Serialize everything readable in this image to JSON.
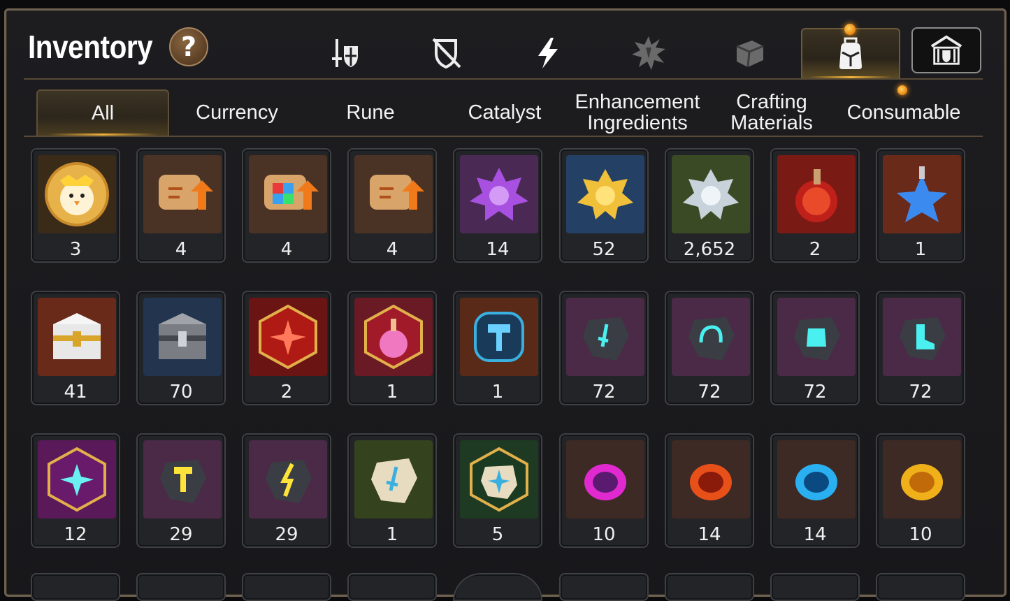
{
  "header": {
    "title": "Inventory",
    "help_label": "?"
  },
  "category_tabs": [
    {
      "icon": "hero-equipment-icon"
    },
    {
      "icon": "artifact-icon"
    },
    {
      "icon": "skill-lightning-icon"
    },
    {
      "icon": "burst-emblem-icon"
    },
    {
      "icon": "box-material-icon"
    },
    {
      "icon": "bag-icon",
      "active": true
    },
    {
      "icon": "guild-storage-icon"
    }
  ],
  "subtabs": [
    "All",
    "Currency",
    "Rune",
    "Catalyst",
    "Enhancement Ingredients",
    "Crafting Materials",
    "Consumable"
  ],
  "active_subtab": "All",
  "items": [
    {
      "icon": "chick-portrait-icon",
      "count": "3"
    },
    {
      "icon": "scroll-upgrade-icon",
      "count": "4"
    },
    {
      "icon": "rainbow-scroll-upgrade-icon",
      "count": "4"
    },
    {
      "icon": "scroll-upgrade-icon",
      "count": "4"
    },
    {
      "icon": "purple-crystal-icon",
      "count": "14"
    },
    {
      "icon": "gold-crystal-icon",
      "count": "52"
    },
    {
      "icon": "silver-crystal-icon",
      "count": "2,652"
    },
    {
      "icon": "red-potion-icon",
      "count": "2"
    },
    {
      "icon": "star-potion-icon",
      "count": "1"
    },
    {
      "icon": "gold-chest-icon",
      "count": "41"
    },
    {
      "icon": "iron-chest-icon",
      "count": "70"
    },
    {
      "icon": "red-rune-stone-icon",
      "count": "2"
    },
    {
      "icon": "pink-potion-icon",
      "count": "1"
    },
    {
      "icon": "hammer-rune-icon",
      "count": "1"
    },
    {
      "icon": "sword-stone-icon",
      "count": "72"
    },
    {
      "icon": "helm-stone-icon",
      "count": "72"
    },
    {
      "icon": "armor-stone-icon",
      "count": "72"
    },
    {
      "icon": "boot-stone-icon",
      "count": "72"
    },
    {
      "icon": "star-stone-icon",
      "count": "12"
    },
    {
      "icon": "hammer-stone-icon",
      "count": "29"
    },
    {
      "icon": "lightning-stone-icon",
      "count": "29"
    },
    {
      "icon": "sword-rock-icon",
      "count": "1"
    },
    {
      "icon": "star-rock-icon",
      "count": "5"
    },
    {
      "icon": "purple-orb-icon",
      "count": "10"
    },
    {
      "icon": "red-orb-icon",
      "count": "14"
    },
    {
      "icon": "blue-orb-icon",
      "count": "14"
    },
    {
      "icon": "gold-orb-icon",
      "count": "10"
    }
  ],
  "colors": {
    "accent": "#f0b23a",
    "frame_border": "#6e6150",
    "slot_bg": "#232427"
  }
}
